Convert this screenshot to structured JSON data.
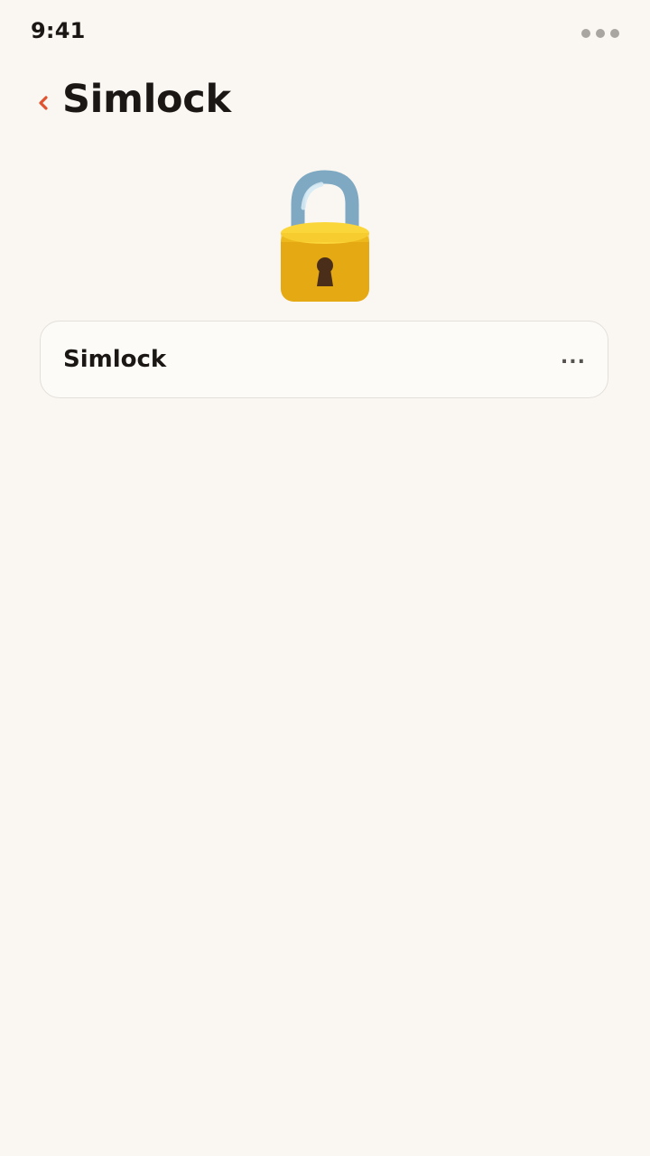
{
  "status_bar": {
    "time": "9:41"
  },
  "header": {
    "title": "Simlock",
    "back_icon": "chevron-left-icon"
  },
  "hero": {
    "icon": "padlock-icon"
  },
  "card": {
    "label": "Simlock",
    "value": "..."
  },
  "colors": {
    "background": "#faf7f2",
    "accent": "#e0532f",
    "card_border": "#e3dfda"
  }
}
